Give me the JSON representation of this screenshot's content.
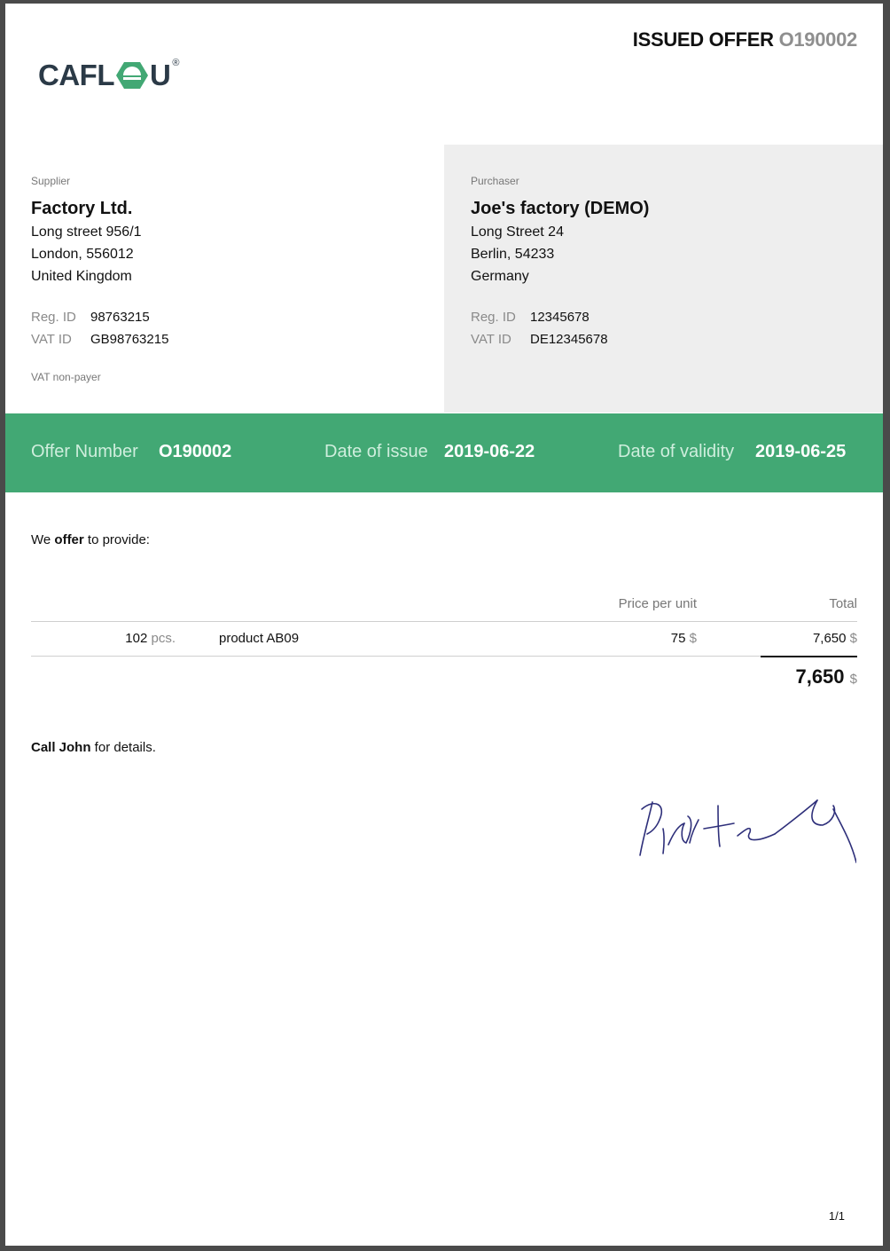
{
  "document": {
    "heading_label": "ISSUED OFFER",
    "heading_number": "O190002",
    "page_indicator": "1/1"
  },
  "logo": {
    "text_left": "CAFL",
    "text_right": "U",
    "registered_mark": "®",
    "icon": "hexagon-o-icon",
    "brand_color": "#42a874",
    "text_color": "#2b3a47"
  },
  "supplier": {
    "label": "Supplier",
    "name": "Factory Ltd.",
    "address": [
      "Long street 956/1",
      "London, 556012",
      "United Kingdom"
    ],
    "reg_id_label": "Reg. ID",
    "reg_id": "98763215",
    "vat_id_label": "VAT ID",
    "vat_id": "GB98763215",
    "vat_note": "VAT non-payer"
  },
  "purchaser": {
    "label": "Purchaser",
    "name": "Joe's factory (DEMO)",
    "address": [
      "Long Street 24",
      "Berlin, 54233",
      "Germany"
    ],
    "reg_id_label": "Reg. ID",
    "reg_id": "12345678",
    "vat_id_label": "VAT ID",
    "vat_id": "DE12345678"
  },
  "band": {
    "color": "#42a874",
    "offer_number_label": "Offer Number",
    "offer_number": "O190002",
    "issue_label": "Date of issue",
    "issue_date": "2019-06-22",
    "validity_label": "Date of validity",
    "validity_date": "2019-06-25"
  },
  "intro": {
    "prefix": "We ",
    "bold": "offer",
    "suffix": " to provide:"
  },
  "items_table": {
    "columns": {
      "price_per_unit": "Price per unit",
      "total": "Total"
    },
    "rows": [
      {
        "quantity": "102",
        "unit": "pcs.",
        "description": "product AB09",
        "price": "75",
        "price_currency": "$",
        "total": "7,650",
        "total_currency": "$"
      }
    ],
    "grand_total": "7,650",
    "grand_total_currency": "$"
  },
  "note": {
    "bold": "Call John",
    "rest": " for details."
  }
}
